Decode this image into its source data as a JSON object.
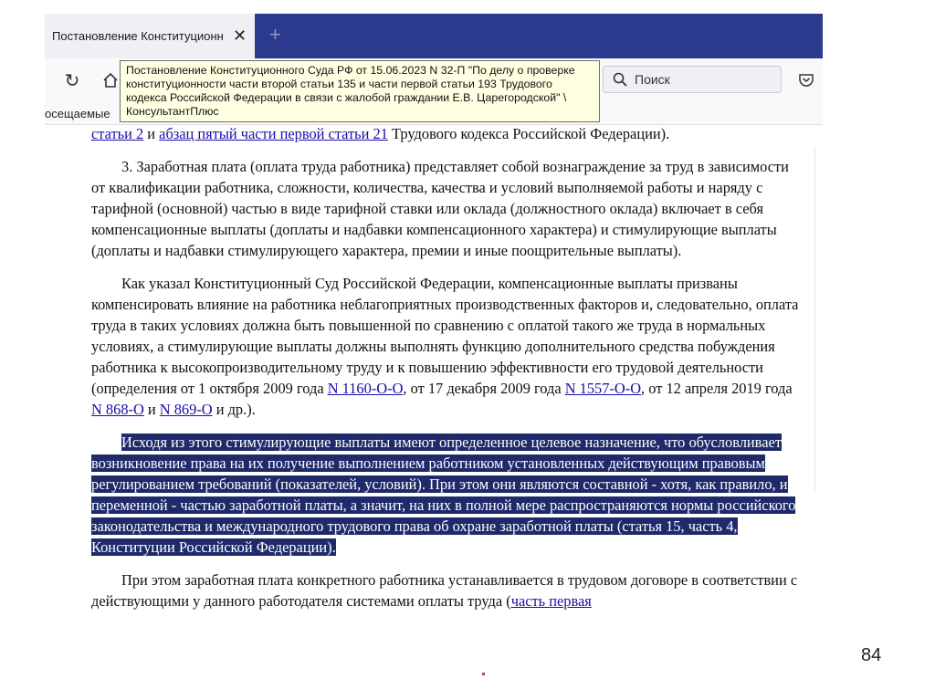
{
  "browser": {
    "tab_title": "Постановление Конституционн",
    "tab_close": "✕",
    "new_tab": "+",
    "reload": "↻",
    "search_placeholder": "Поиск",
    "bookmarks_text": "осещаемые",
    "tooltip": "Постановление Конституционного Суда РФ от 15.06.2023 N 32-П \"По делу о проверке конституционности части второй статьи 135 и части первой статьи 193 Трудового кодекса Российской Федерации в связи с жалобой граждании Е.В. Царегородской\" \\ КонсультантПлюс"
  },
  "document": {
    "top_link1": "статьи 2",
    "top_and": " и ",
    "top_link2": "абзац пятый части первой статьи 21",
    "top_tail": " Трудового кодекса Российской Федерации).",
    "p3": "3. Заработная плата (оплата труда работника) представляет собой вознаграждение за труд в зависимости от квалификации работника, сложности, количества, качества и условий выполняемой работы и наряду с тарифной (основной) частью в виде тарифной ставки или оклада (должностного оклада) включает в себя компенсационные выплаты (доплаты и надбавки компенсационного характера) и стимулирующие выплаты (доплаты и надбавки стимулирующего характера, премии и иные поощрительные выплаты).",
    "p4_text": "Как указал Конституционный Суд Российской Федерации, компенсационные выплаты призваны компенсировать влияние на работника неблагоприятных производственных факторов и, следовательно, оплата труда в таких условиях должна быть повышенной по сравнению с оплатой такого же труда в нормальных условиях, а стимулирующие выплаты должны выполнять функцию дополнительного средства побуждения работника к высокопроизводительному труду и к повышению эффективности его трудовой деятельности (определения от 1 октября 2009 года ",
    "p4_link1": "N 1160-О-О",
    "p4_mid1": ", от 17 декабря 2009 года ",
    "p4_link2": "N 1557-О-О",
    "p4_mid2": ", от 12 апреля 2019 года ",
    "p4_link3": "N 868-О",
    "p4_and": " и ",
    "p4_link4": "N 869-О",
    "p4_end": " и др.).",
    "p5_highlighted": "Исходя из этого стимулирующие выплаты имеют определенное целевое назначение, что обусловливает возникновение права на их получение выполнением работником установленных действующим правовым регулированием требований (показателей, условий). При этом они являются составной - хотя, как правило, и переменной - частью заработной платы, а значит, на них в полной мере распространяются нормы российского законодательства и международного трудового права об охране заработной платы (статья 15, часть 4, Конституции Российской Федерации).",
    "p6_text": "При этом заработная плата конкретного работника устанавливается в трудовом договоре в соответствии с действующими у данного работодателя системами оплаты труда (",
    "p6_link": "часть первая"
  },
  "slide": {
    "page_number": "84"
  },
  "colors": {
    "tabbar": "#2b3a8c",
    "highlight": "#1f2a6b",
    "link": "#1a0dab",
    "tooltip_bg": "#ffffe1"
  }
}
